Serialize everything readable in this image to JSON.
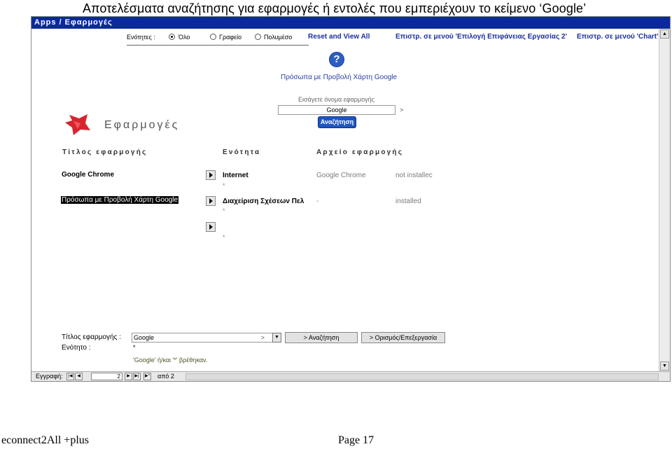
{
  "document": {
    "heading": "Αποτελέσματα αναζήτησης για εφαρμογές ή εντολές που εμπεριέχουν το κείμενο ‘Google’",
    "footer_left": "econnect2All  +plus",
    "footer_right": "Page 17"
  },
  "window": {
    "title": "Apps / Εφαρμογές"
  },
  "filter": {
    "label": "Ενότητες :",
    "options": [
      "Όλο",
      "Γραφείο",
      "Πολυμέσο"
    ],
    "selected": "Όλο"
  },
  "toolbar": {
    "reset_label": "Reset  and View All",
    "return_menu_label": "Επιστρ. σε μενού 'Επιλογή Επιφάνειας Εργασίας 2'",
    "return_chart_label": "Επιστρ. σε μενού 'Chart'"
  },
  "help": {
    "icon": "question-icon",
    "link_text": "Πρόσωπα με Προβολή Χάρτη Google"
  },
  "search": {
    "label": "Εισάγετε όνομα εφαρμογής",
    "value": "Google",
    "arrow": ">",
    "button_label": "Αναζήτηση"
  },
  "brand": {
    "title": "Εφαρμογές"
  },
  "columns": {
    "title": "Τίτλος εφαρμογής",
    "section": "Ενότητα",
    "file": "Αρχείο εφαρμογής"
  },
  "rows": [
    {
      "title": "Google Chrome",
      "section": "Internet",
      "file": "Google Chrome",
      "status": "not installec",
      "marker": "*"
    },
    {
      "title": "Πρόσωπα με Προβολή Χάρτη Google",
      "section": "Διαχείριση Σχέσεων Πελ",
      "file": "-",
      "status": "installed",
      "marker": "*"
    },
    {
      "title": "",
      "section": "",
      "file": "",
      "status": "",
      "marker": "*"
    }
  ],
  "form": {
    "title_label": "Τίτλος εφαρμογής :",
    "title_value": "Google",
    "title_arrow": ">",
    "section_label": "Ενότητο :",
    "section_value": "*",
    "search_button": "> Αναζήτηση",
    "define_button": "> Ορισμός/Επεξεργασία",
    "found_message": "'Google' ή/και '*' βρέθηκαν."
  },
  "record_nav": {
    "label": "Εγγραφή:",
    "current": "2",
    "of_text": "από 2"
  },
  "colors": {
    "titlebar": "#0b2a9a",
    "link": "#1b2f9f",
    "button": "#1e56c2",
    "logo": "#d8242c"
  }
}
